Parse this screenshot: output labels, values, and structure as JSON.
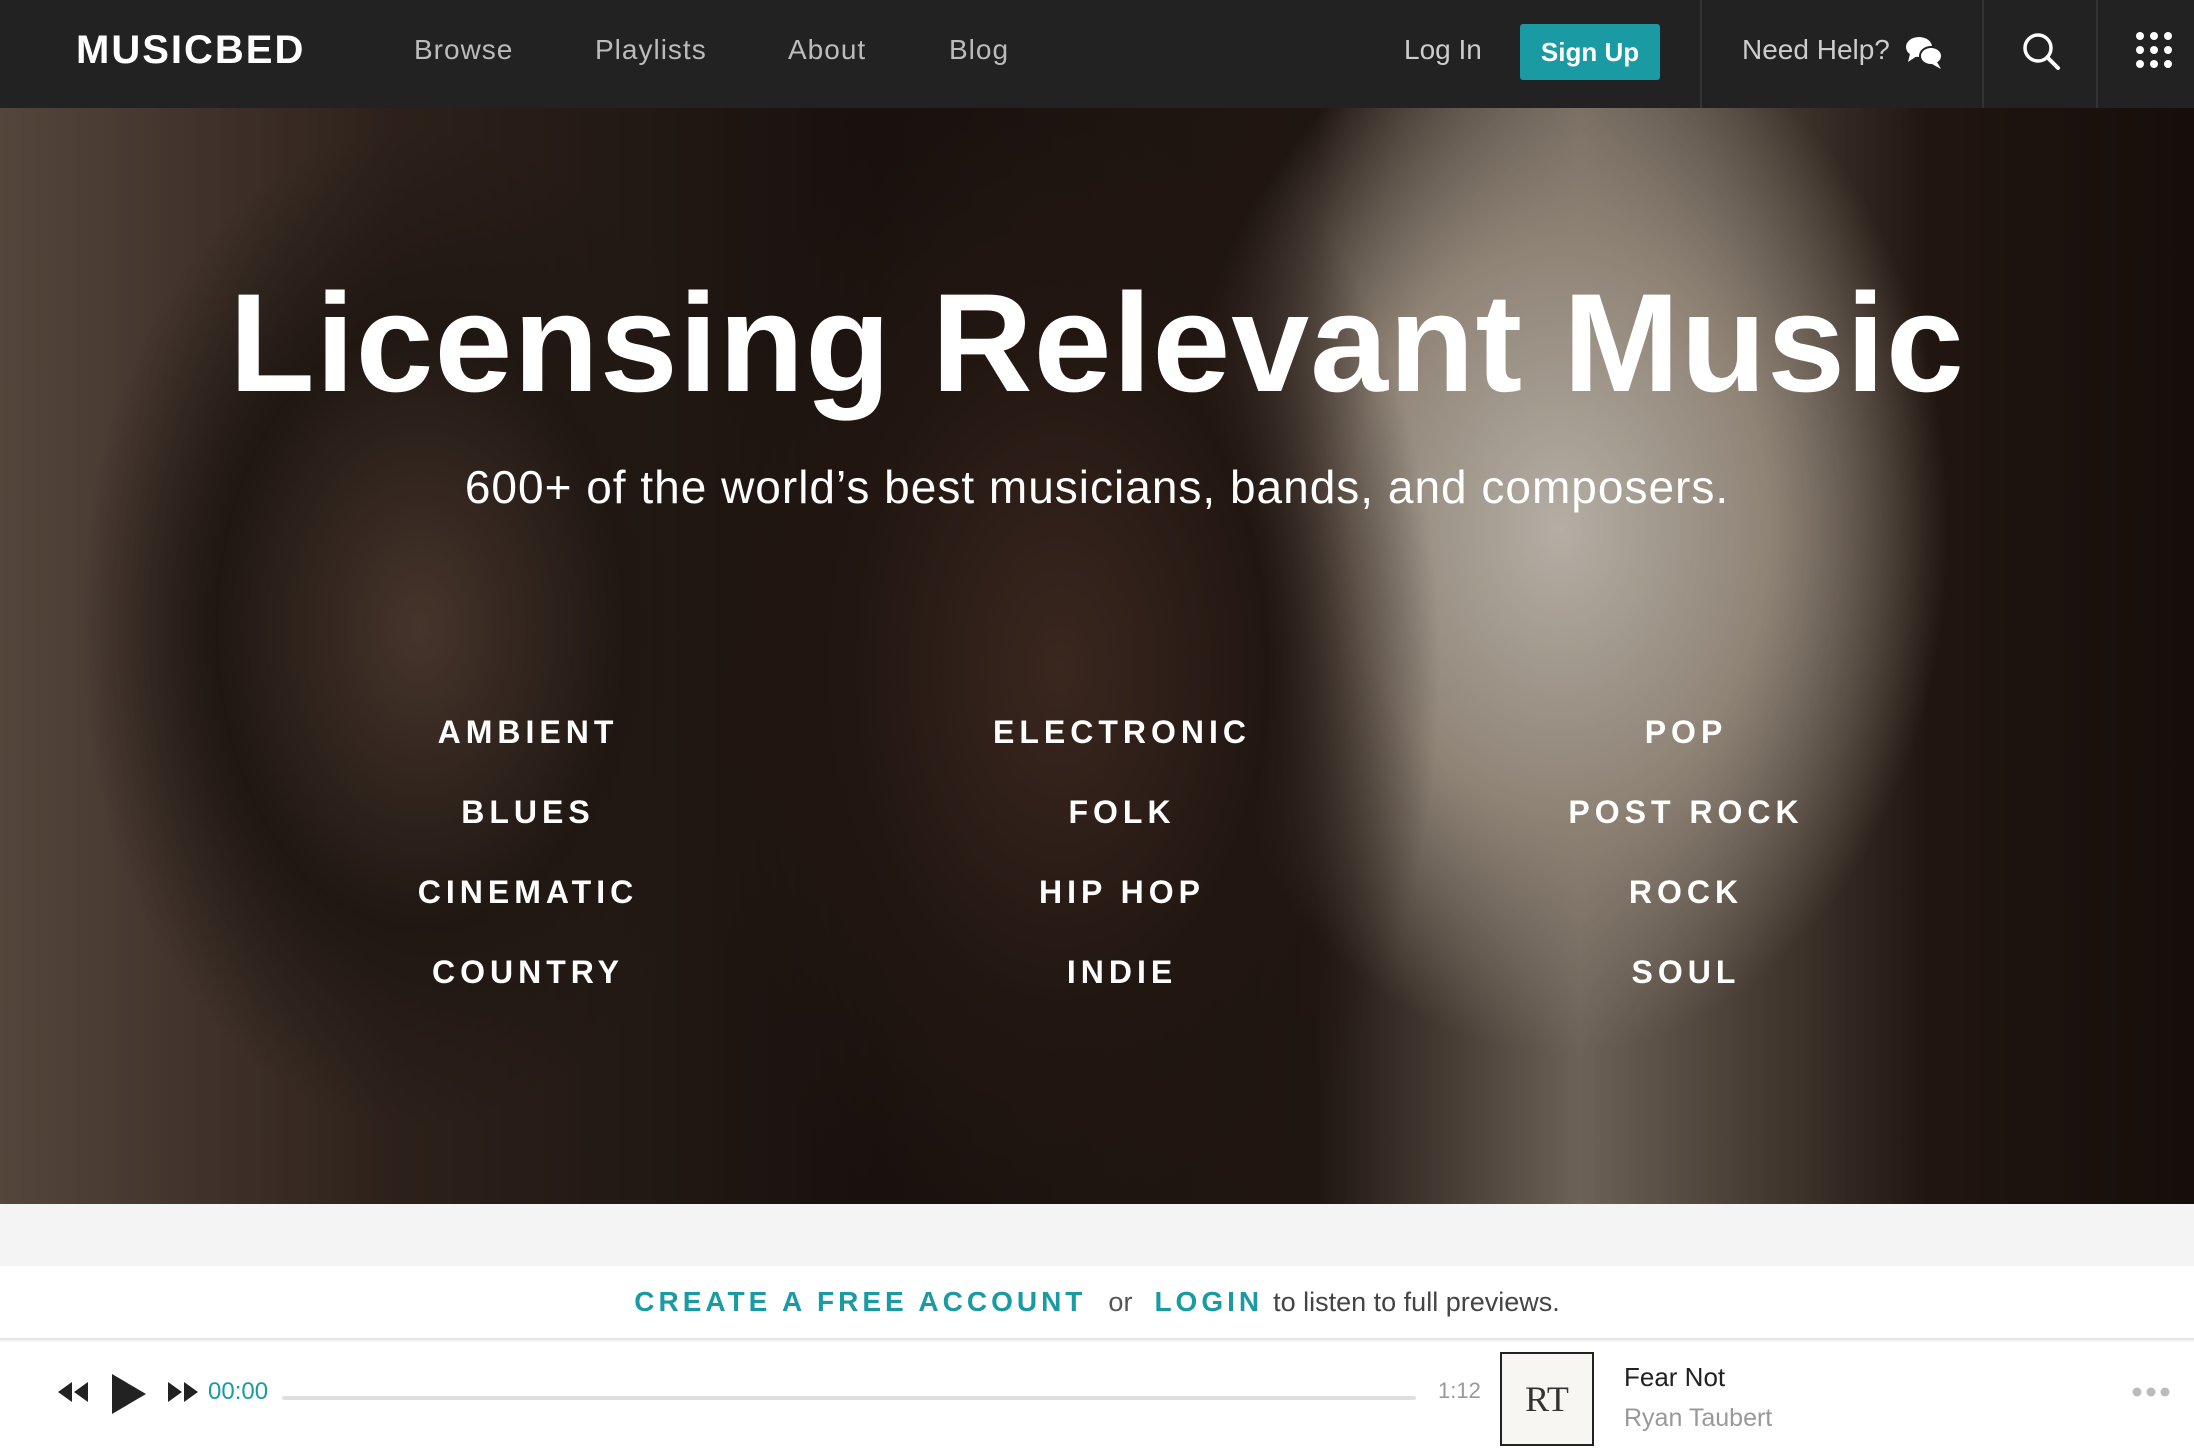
{
  "navbar": {
    "logo": "MUSICBED",
    "links": [
      "Browse",
      "Playlists",
      "About",
      "Blog"
    ],
    "login": "Log In",
    "signup": "Sign Up",
    "help": "Need Help?"
  },
  "hero": {
    "title": "Licensing Relevant Music",
    "subtitle": "600+ of the world’s best musicians, bands, and composers.",
    "genres": {
      "col1": [
        "AMBIENT",
        "BLUES",
        "CINEMATIC",
        "COUNTRY"
      ],
      "col2": [
        "ELECTRONIC",
        "FOLK",
        "HIP HOP",
        "INDIE"
      ],
      "col3": [
        "POP",
        "POST ROCK",
        "ROCK",
        "SOUL"
      ]
    }
  },
  "cta": {
    "create": "CREATE A FREE ACCOUNT",
    "or": "or",
    "login": "LOGIN",
    "tail": "to listen to full previews."
  },
  "player": {
    "current_time": "00:00",
    "total_time": "1:12",
    "album_initials": "RT",
    "track_title": "Fear Not",
    "artist": "Ryan Taubert",
    "progress": 0
  },
  "colors": {
    "accent": "#1a9ba3",
    "navbar_bg": "#222222"
  },
  "icons": [
    "chat-bubbles-icon",
    "search-icon",
    "apps-grid-icon",
    "rewind-icon",
    "play-icon",
    "fast-forward-icon",
    "more-icon"
  ]
}
